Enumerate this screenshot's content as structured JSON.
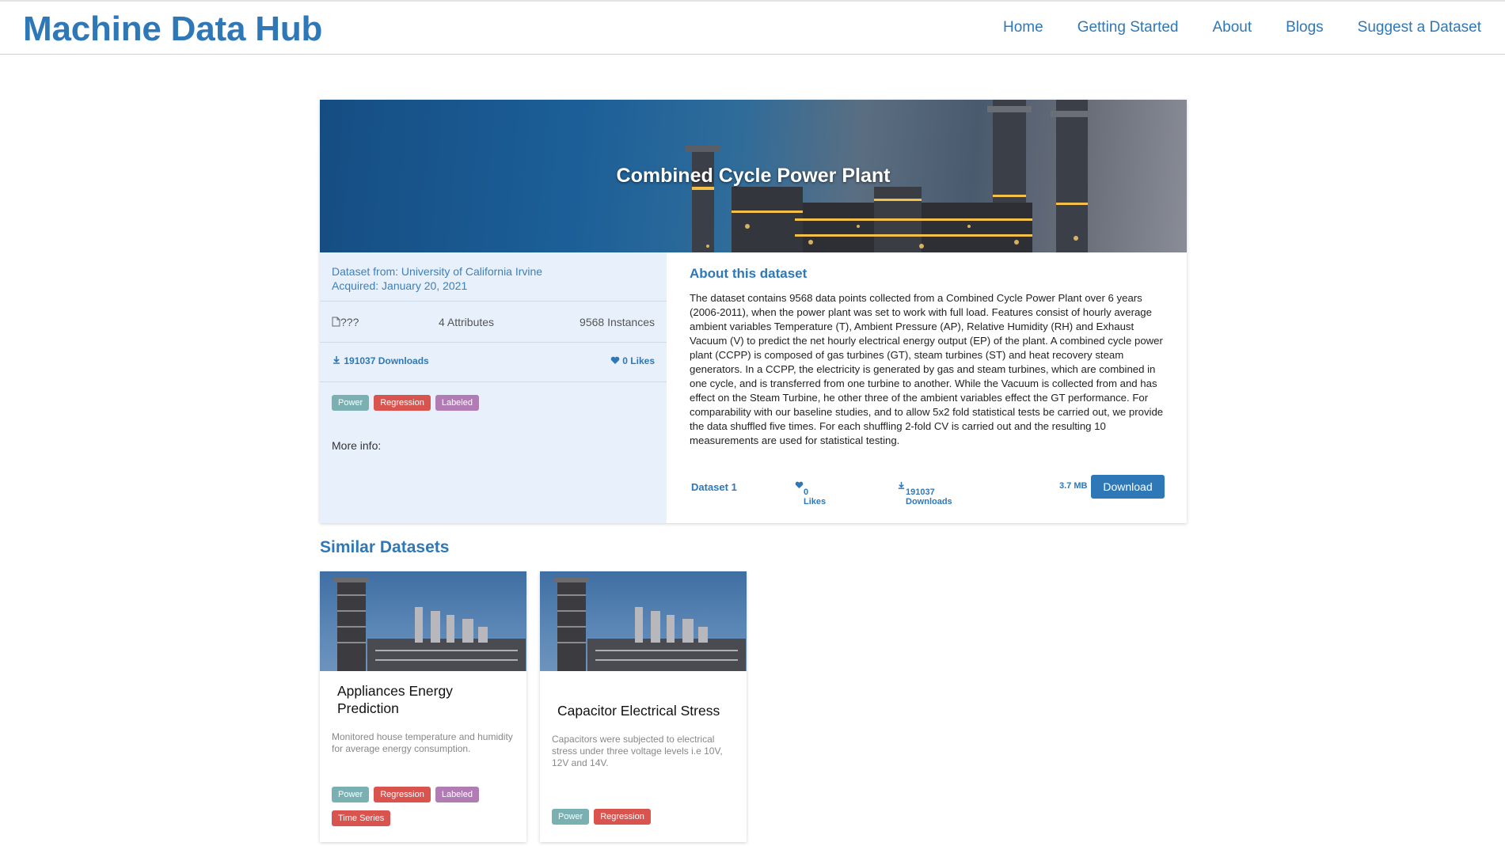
{
  "header": {
    "brand": "Machine Data Hub",
    "nav": [
      "Home",
      "Getting Started",
      "About",
      "Blogs",
      "Suggest a Dataset"
    ]
  },
  "dataset": {
    "title": "Combined Cycle Power Plant",
    "source": "Dataset from: University of California Irvine",
    "acquired": "Acquired: January 20, 2021",
    "file_type": "???",
    "attributes": "4 Attributes",
    "instances": "9568 Instances",
    "downloads": "191037 Downloads",
    "likes": "0 Likes",
    "tags": [
      "Power",
      "Regression",
      "Labeled"
    ],
    "more_info": "More info:",
    "about_title": "About this dataset",
    "about_text": "The dataset contains 9568 data points collected from a Combined Cycle Power Plant over 6 years (2006-2011), when the power plant was set to work with full load. Features consist of hourly average ambient variables Temperature (T), Ambient Pressure (AP), Relative Humidity (RH) and Exhaust Vacuum (V) to predict the net hourly electrical energy output (EP) of the plant. A combined cycle power plant (CCPP) is composed of gas turbines (GT), steam turbines (ST) and heat recovery steam generators. In a CCPP, the electricity is generated by gas and steam turbines, which are combined in one cycle, and is transferred from one turbine to another. While the Vacuum is collected from and has effect on the Steam Turbine, he other three of the ambient variables effect the GT performance. For comparability with our baseline studies, and to allow 5x2 fold statistical tests be carried out, we provide the data shuffled five times. For each shuffling 2-fold CV is carried out and the resulting 10 measurements are used for statistical testing.",
    "file": {
      "name": "Dataset 1",
      "likes": "0 Likes",
      "downloads": "191037 Downloads",
      "size": "3.7 MB",
      "download_label": "Download"
    }
  },
  "similar": {
    "title": "Similar Datasets",
    "cards": [
      {
        "title": "Appliances Energy Prediction",
        "desc": "Monitored house temperature and humidity for average energy consumption.",
        "tags": [
          "Power",
          "Regression",
          "Labeled",
          "Time Series"
        ]
      },
      {
        "title": "Capacitor Electrical Stress",
        "desc": "Capacitors were subjected to electrical stress under three voltage levels i.e 10V, 12V and 14V.",
        "tags": [
          "Power",
          "Regression"
        ]
      }
    ]
  },
  "colors": {
    "brand": "#2f78b7",
    "tag_power": "#7bb0b3",
    "tag_regression": "#d9534f",
    "tag_labeled": "#b07cb3"
  },
  "icons": [
    "file-icon",
    "download-icon",
    "heart-icon"
  ]
}
